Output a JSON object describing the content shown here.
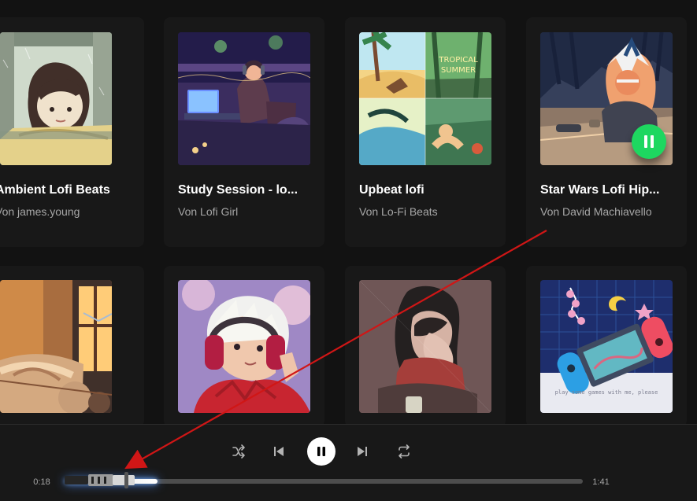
{
  "playlist_cards": [
    {
      "title": "Ambient Lofi Beats",
      "subtitle": "Von james.young",
      "art": "window-rain-girl-art"
    },
    {
      "title": "Study Session - lo...",
      "subtitle": "Von Lofi Girl",
      "art": "night-study-room-art"
    },
    {
      "title": "Upbeat lofi",
      "subtitle": "Von Lo-Fi Beats",
      "art": "tropical-summer-art"
    },
    {
      "title": "Star Wars Lofi Hip...",
      "subtitle": "Von David Machiavello",
      "art": "space-room-art",
      "playing": true
    },
    {
      "title": "",
      "subtitle": "",
      "art": "sunset-bedroom-art"
    },
    {
      "title": "",
      "subtitle": "",
      "art": "headphones-boy-art"
    },
    {
      "title": "",
      "subtitle": "",
      "art": "tired-girl-art"
    },
    {
      "title": "",
      "subtitle": "",
      "art": "switch-console-art",
      "art_caption": "play some games with me, please"
    }
  ],
  "player": {
    "elapsed": "0:18",
    "duration": "1:41",
    "progress_fraction": 0.18,
    "controls": {
      "shuffle_icon": "shuffle-icon",
      "previous_icon": "previous-track-icon",
      "play_pause_icon": "pause-icon",
      "next_icon": "next-track-icon",
      "repeat_icon": "repeat-icon"
    }
  },
  "overlays": {
    "annotation": "red-arrow-icon",
    "decoration": "lightsaber-progress-slider"
  },
  "colors": {
    "background": "#121212",
    "card": "#181818",
    "accent": "#1ed760",
    "annotation": "#d01616",
    "text_muted": "#a7a7a7"
  }
}
